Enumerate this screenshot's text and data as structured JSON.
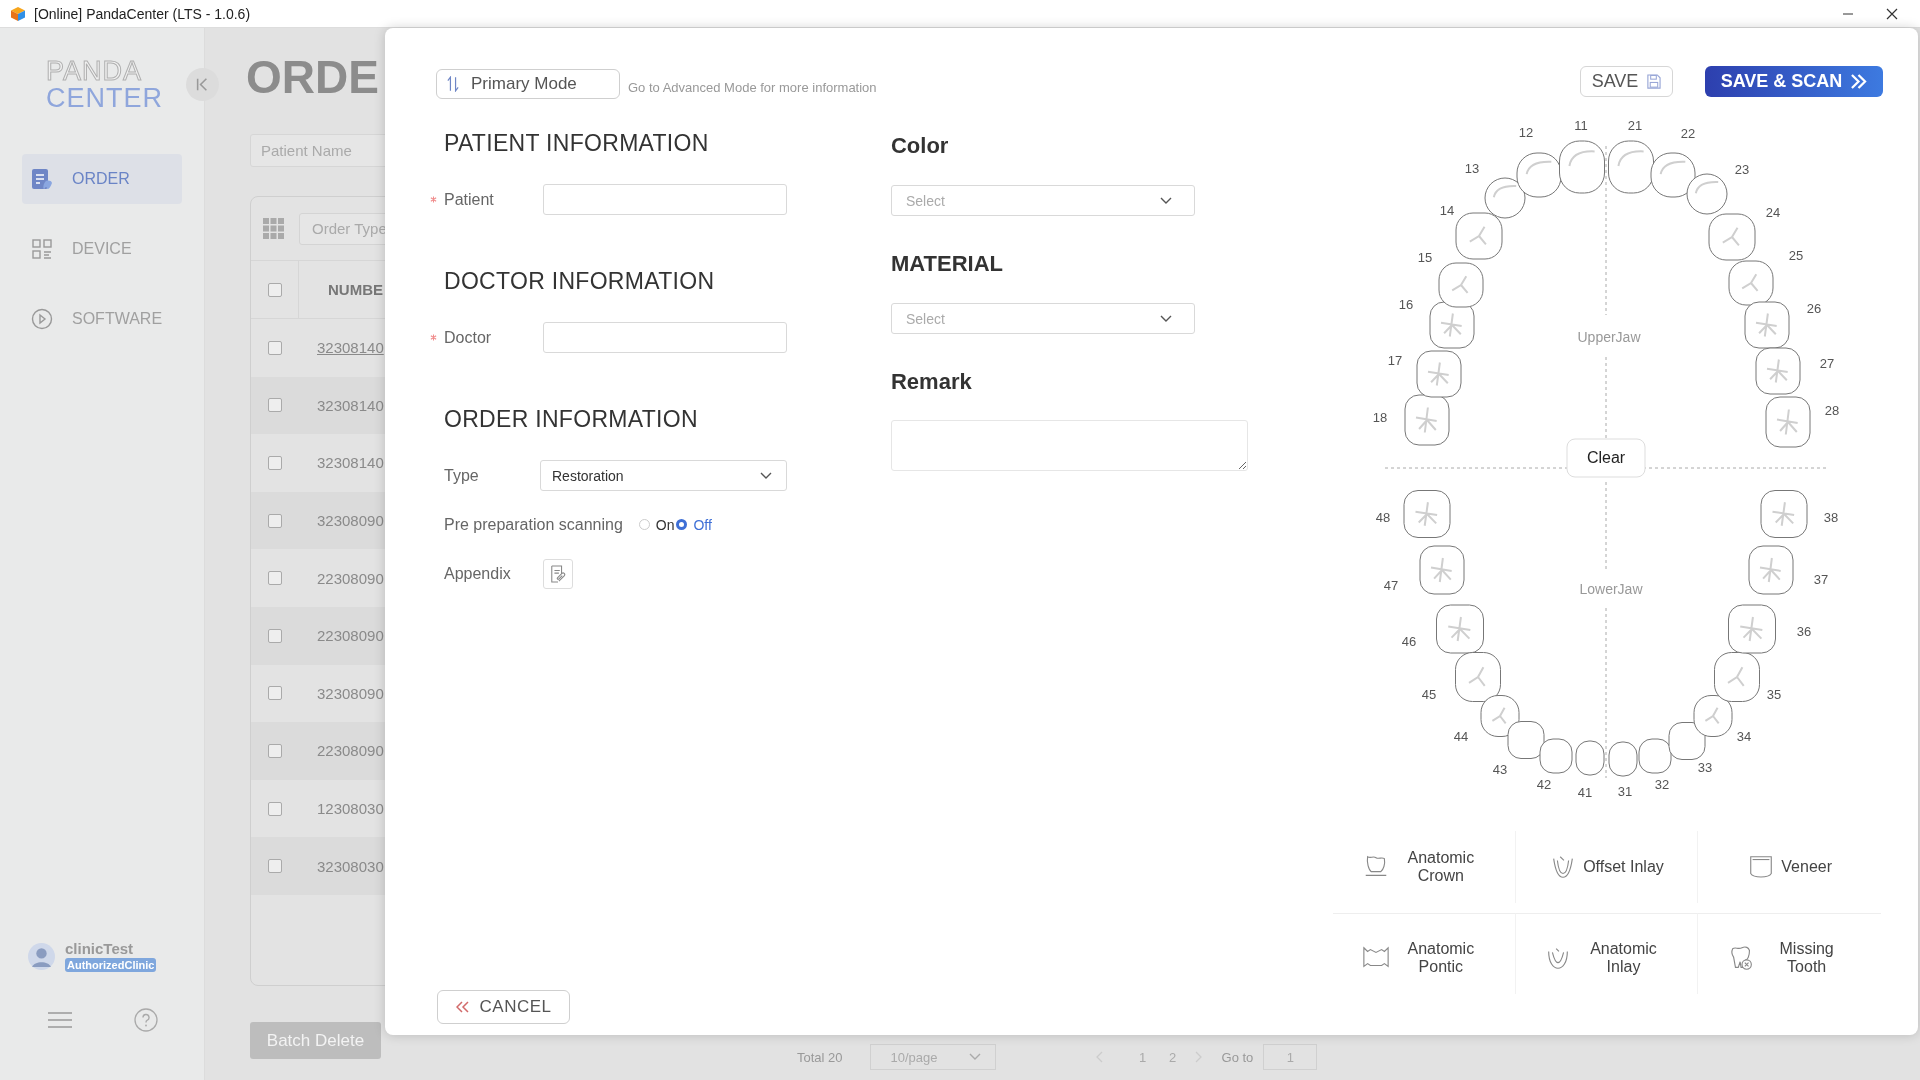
{
  "window": {
    "title": "[Online] PandaCenter (LTS - 1.0.6)"
  },
  "sidebar": {
    "logo_top": "PANDA",
    "logo_bottom": "CENTER",
    "items": [
      {
        "kind": "order",
        "label": "ORDER",
        "selected": true
      },
      {
        "kind": "device",
        "label": "DEVICE",
        "selected": false
      },
      {
        "kind": "software",
        "label": "SOFTWARE",
        "selected": false
      }
    ],
    "user": {
      "name": "clinicTest",
      "role": "AuthorizedClinic"
    }
  },
  "page": {
    "title": "ORDE",
    "search": {
      "placeholder": "Patient Name"
    },
    "filter": {
      "placeholder": "Order Type"
    },
    "table": {
      "columns": [
        "NUMBE"
      ],
      "header_checked": false,
      "rows": [
        {
          "number": "32308140",
          "checked": false,
          "hovered": true
        },
        {
          "number": "32308140",
          "checked": false,
          "hovered": false
        },
        {
          "number": "32308140",
          "checked": false,
          "hovered": false
        },
        {
          "number": "32308090",
          "checked": false,
          "hovered": false
        },
        {
          "number": "22308090",
          "checked": false,
          "hovered": false
        },
        {
          "number": "22308090",
          "checked": false,
          "hovered": false
        },
        {
          "number": "32308090",
          "checked": false,
          "hovered": false
        },
        {
          "number": "22308090",
          "checked": false,
          "hovered": false
        },
        {
          "number": "12308030",
          "checked": false,
          "hovered": false
        },
        {
          "number": "32308030",
          "checked": false,
          "hovered": false
        }
      ]
    },
    "batch_delete": "Batch Delete",
    "pagination": {
      "total": "Total 20",
      "page_size": "10/page",
      "pages": [
        "1",
        "2"
      ],
      "goto_label": "Go to",
      "goto_value": "1"
    }
  },
  "dialog": {
    "mode_button": "Primary Mode",
    "mode_hint": "Go to Advanced Mode for more information",
    "save": "SAVE",
    "save_scan": "SAVE & SCAN",
    "left_sections": [
      {
        "heading": "PATIENT INFORMATION",
        "fields": [
          {
            "kind": "text",
            "label": "Patient",
            "required": true
          }
        ]
      },
      {
        "heading": "DOCTOR INFORMATION",
        "fields": [
          {
            "kind": "text",
            "label": "Doctor",
            "required": true
          }
        ]
      },
      {
        "heading": "ORDER INFORMATION",
        "fields": [
          {
            "kind": "select",
            "label": "Type",
            "required": false,
            "value": "Restoration"
          },
          {
            "kind": "radio",
            "label": "Pre preparation scanning",
            "required": false,
            "options": [
              {
                "label": "On",
                "selected": false
              },
              {
                "label": "Off",
                "selected": true
              }
            ]
          },
          {
            "kind": "attachment",
            "label": "Appendix",
            "required": false
          }
        ]
      }
    ],
    "right_sections": [
      {
        "heading": "Color",
        "kind": "select",
        "placeholder": "Select"
      },
      {
        "heading": "MATERIAL",
        "kind": "select",
        "placeholder": "Select"
      },
      {
        "heading": "Remark",
        "kind": "textarea"
      }
    ],
    "chart": {
      "upper_label": "UpperJaw",
      "lower_label": "LowerJaw",
      "clear": "Clear",
      "upper_teeth": [
        {
          "number": "18",
          "kind": "molar",
          "selected": false
        },
        {
          "number": "17",
          "kind": "molar",
          "selected": false
        },
        {
          "number": "16",
          "kind": "molar",
          "selected": false
        },
        {
          "number": "15",
          "kind": "premolar",
          "selected": false
        },
        {
          "number": "14",
          "kind": "premolar",
          "selected": false
        },
        {
          "number": "13",
          "kind": "incisor",
          "selected": false
        },
        {
          "number": "12",
          "kind": "incisor",
          "selected": false
        },
        {
          "number": "11",
          "kind": "incisor",
          "selected": false
        },
        {
          "number": "21",
          "kind": "incisor",
          "selected": false
        },
        {
          "number": "22",
          "kind": "incisor",
          "selected": false
        },
        {
          "number": "23",
          "kind": "incisor",
          "selected": false
        },
        {
          "number": "24",
          "kind": "premolar",
          "selected": false
        },
        {
          "number": "25",
          "kind": "premolar",
          "selected": false
        },
        {
          "number": "26",
          "kind": "molar",
          "selected": false
        },
        {
          "number": "27",
          "kind": "molar",
          "selected": false
        },
        {
          "number": "28",
          "kind": "molar",
          "selected": false
        }
      ],
      "lower_teeth": [
        {
          "number": "48",
          "kind": "molar",
          "selected": false
        },
        {
          "number": "47",
          "kind": "molar",
          "selected": false
        },
        {
          "number": "46",
          "kind": "molar",
          "selected": false
        },
        {
          "number": "45",
          "kind": "premolar",
          "selected": false
        },
        {
          "number": "44",
          "kind": "premolar",
          "selected": false
        },
        {
          "number": "43",
          "kind": "plain",
          "selected": false
        },
        {
          "number": "42",
          "kind": "plain",
          "selected": false
        },
        {
          "number": "41",
          "kind": "plain",
          "selected": false
        },
        {
          "number": "31",
          "kind": "plain",
          "selected": false
        },
        {
          "number": "32",
          "kind": "plain",
          "selected": false
        },
        {
          "number": "33",
          "kind": "plain",
          "selected": false
        },
        {
          "number": "34",
          "kind": "premolar",
          "selected": false
        },
        {
          "number": "35",
          "kind": "premolar",
          "selected": false
        },
        {
          "number": "36",
          "kind": "molar",
          "selected": false
        },
        {
          "number": "37",
          "kind": "molar",
          "selected": false
        },
        {
          "number": "38",
          "kind": "molar",
          "selected": false
        }
      ]
    },
    "restorations": [
      {
        "kind": "crown",
        "label": "Anatomic Crown"
      },
      {
        "kind": "offset-inlay",
        "label": "Offset Inlay"
      },
      {
        "kind": "veneer",
        "label": "Veneer"
      },
      {
        "kind": "pontic",
        "label": "Anatomic Pontic"
      },
      {
        "kind": "inlay",
        "label": "Anatomic Inlay"
      },
      {
        "kind": "missing",
        "label": "Missing Tooth"
      }
    ],
    "cancel": "CANCEL"
  }
}
